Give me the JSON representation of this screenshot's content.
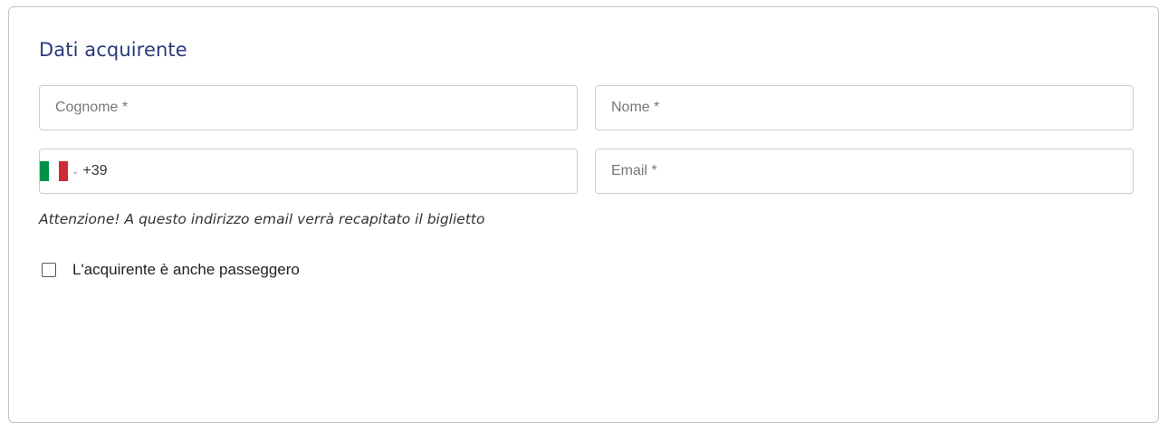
{
  "section": {
    "title": "Dati acquirente"
  },
  "fields": {
    "cognome": {
      "placeholder": "Cognome *",
      "value": ""
    },
    "nome": {
      "placeholder": "Nome *",
      "value": ""
    },
    "phone": {
      "country_flag": "italy-flag-icon",
      "dial_code": "+39",
      "value": ""
    },
    "email": {
      "placeholder": "Email *",
      "value": ""
    }
  },
  "note": "Attenzione! A questo indirizzo email verrà recapitato il biglietto",
  "checkbox": {
    "label": "L'acquirente è anche passeggero",
    "checked": false
  },
  "colors": {
    "title": "#2a3a7a",
    "flag_green": "#009246",
    "flag_white": "#ffffff",
    "flag_red": "#ce2b37"
  }
}
